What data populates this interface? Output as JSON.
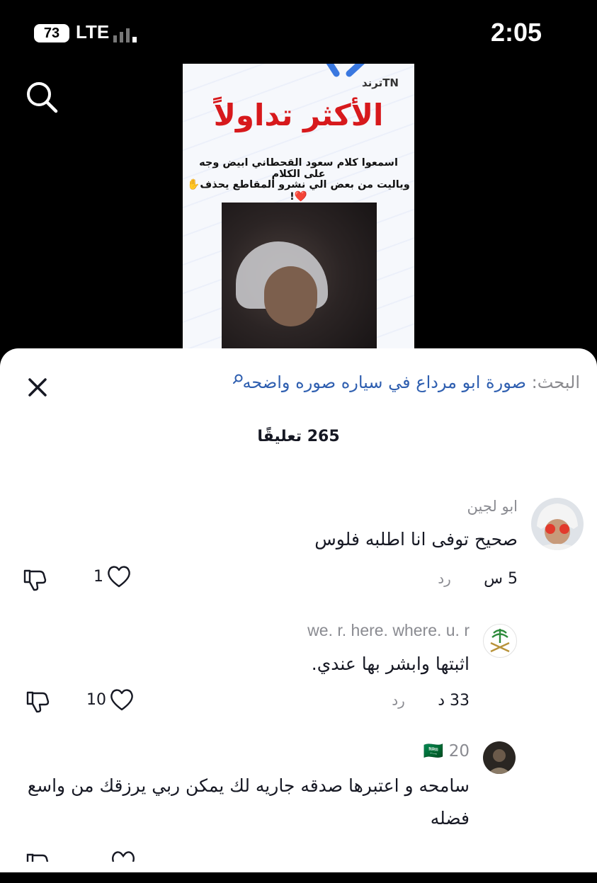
{
  "status_bar": {
    "battery": "73",
    "network": "LTE",
    "time": "2:05"
  },
  "video": {
    "brand": "ترندTN",
    "headline": "الأكثر تداولاً",
    "caption_line1": "اسمعوا كلام سعود القحطاني ابيض وجه على الكلام",
    "caption_line2": "وياليت من بعض الي نشرو المقاطع يحذف✋❤️!"
  },
  "search_bar": {
    "prefix": "البحث:",
    "query": "صورة ابو مرداع في سياره صوره واضحه"
  },
  "comments_header": {
    "count_label": "265 تعليقًا"
  },
  "comments": [
    {
      "username": "ابو لجين",
      "text": "صحيح توفى انا اطلبه فلوس",
      "age": "5 س",
      "reply_label": "رد",
      "likes": "1"
    },
    {
      "username": "we. r. here. where. u. r",
      "text": "اثبتها وابشر بها عندي.",
      "age": "33 د",
      "reply_label": "رد",
      "likes": "10"
    },
    {
      "username": "20 🇸🇦",
      "text": "سامحه و اعتبرها صدقه جاريه لك يمكن ربي يرزقك من واسع فضله",
      "likes": ""
    }
  ],
  "icons": {
    "search": "search-icon",
    "close": "close-icon",
    "like": "heart-icon",
    "dislike": "thumbs-down-icon"
  },
  "colors": {
    "headline_red": "#d7191c",
    "search_query_blue": "#2f5fb0",
    "muted_gray": "#8a8b91"
  }
}
